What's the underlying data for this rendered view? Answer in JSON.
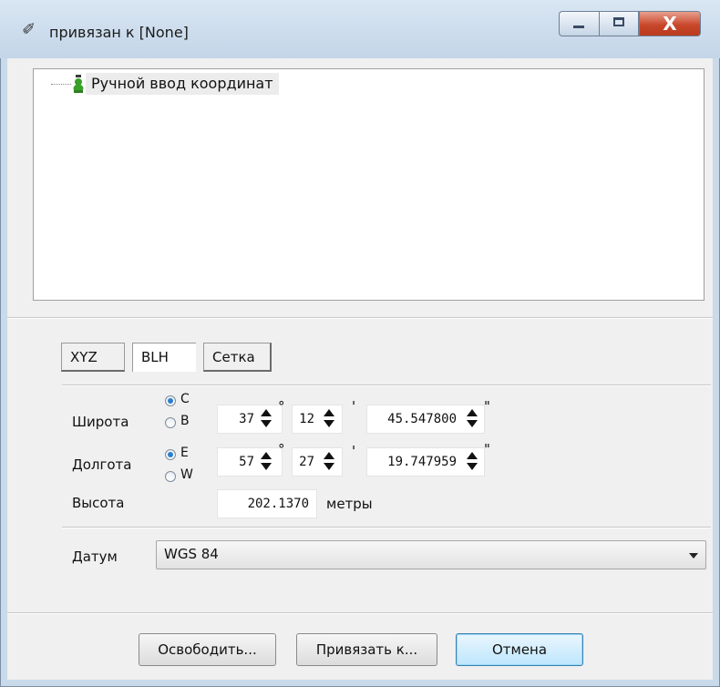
{
  "window": {
    "title": "привязан к [None]",
    "icon": "map-pin-icon",
    "caption_buttons": {
      "minimize": "minimize-icon",
      "maximize": "maximize-icon",
      "close_glyph": "X"
    }
  },
  "tree": {
    "items": [
      {
        "label": "Ручной ввод координат",
        "icon": "green-marker-icon"
      }
    ]
  },
  "tabs": [
    {
      "label": "XYZ",
      "selected": false
    },
    {
      "label": "BLH",
      "selected": true
    },
    {
      "label": "Сетка",
      "selected": false
    }
  ],
  "latitude": {
    "label": "Широта",
    "options": [
      {
        "label": "C",
        "checked": true
      },
      {
        "label": "B",
        "checked": false
      }
    ],
    "degrees": "37",
    "minutes": "12",
    "seconds": "45.547800",
    "deg_unit": "°",
    "min_unit": "'",
    "sec_unit": "\""
  },
  "longitude": {
    "label": "Долгота",
    "options": [
      {
        "label": "E",
        "checked": true
      },
      {
        "label": "W",
        "checked": false
      }
    ],
    "degrees": "57",
    "minutes": "27",
    "seconds": "19.747959",
    "deg_unit": "°",
    "min_unit": "'",
    "sec_unit": "\""
  },
  "altitude": {
    "label": "Высота",
    "value": "202.1370",
    "unit": "метры"
  },
  "datum": {
    "label": "Датум",
    "value": "WGS 84"
  },
  "buttons": {
    "release": "Освободить...",
    "bind": "Привязать к...",
    "cancel": "Отмена"
  },
  "colors": {
    "accent": "#2a7fcf",
    "close_button": "#c9482c",
    "marker": "#3aa02a"
  }
}
